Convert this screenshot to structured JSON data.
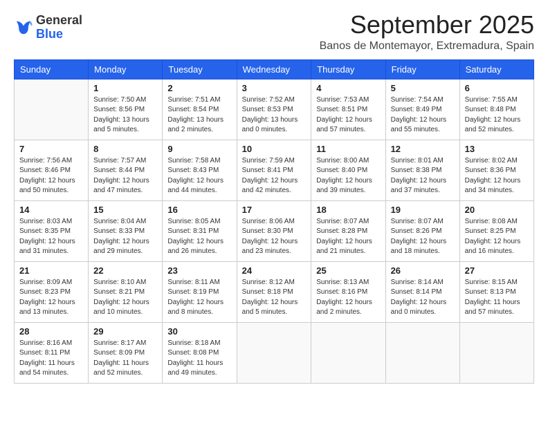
{
  "logo": {
    "general": "General",
    "blue": "Blue"
  },
  "title": "September 2025",
  "location": "Banos de Montemayor, Extremadura, Spain",
  "days_of_week": [
    "Sunday",
    "Monday",
    "Tuesday",
    "Wednesday",
    "Thursday",
    "Friday",
    "Saturday"
  ],
  "weeks": [
    [
      {
        "day": "",
        "info": ""
      },
      {
        "day": "1",
        "info": "Sunrise: 7:50 AM\nSunset: 8:56 PM\nDaylight: 13 hours\nand 5 minutes."
      },
      {
        "day": "2",
        "info": "Sunrise: 7:51 AM\nSunset: 8:54 PM\nDaylight: 13 hours\nand 2 minutes."
      },
      {
        "day": "3",
        "info": "Sunrise: 7:52 AM\nSunset: 8:53 PM\nDaylight: 13 hours\nand 0 minutes."
      },
      {
        "day": "4",
        "info": "Sunrise: 7:53 AM\nSunset: 8:51 PM\nDaylight: 12 hours\nand 57 minutes."
      },
      {
        "day": "5",
        "info": "Sunrise: 7:54 AM\nSunset: 8:49 PM\nDaylight: 12 hours\nand 55 minutes."
      },
      {
        "day": "6",
        "info": "Sunrise: 7:55 AM\nSunset: 8:48 PM\nDaylight: 12 hours\nand 52 minutes."
      }
    ],
    [
      {
        "day": "7",
        "info": "Sunrise: 7:56 AM\nSunset: 8:46 PM\nDaylight: 12 hours\nand 50 minutes."
      },
      {
        "day": "8",
        "info": "Sunrise: 7:57 AM\nSunset: 8:44 PM\nDaylight: 12 hours\nand 47 minutes."
      },
      {
        "day": "9",
        "info": "Sunrise: 7:58 AM\nSunset: 8:43 PM\nDaylight: 12 hours\nand 44 minutes."
      },
      {
        "day": "10",
        "info": "Sunrise: 7:59 AM\nSunset: 8:41 PM\nDaylight: 12 hours\nand 42 minutes."
      },
      {
        "day": "11",
        "info": "Sunrise: 8:00 AM\nSunset: 8:40 PM\nDaylight: 12 hours\nand 39 minutes."
      },
      {
        "day": "12",
        "info": "Sunrise: 8:01 AM\nSunset: 8:38 PM\nDaylight: 12 hours\nand 37 minutes."
      },
      {
        "day": "13",
        "info": "Sunrise: 8:02 AM\nSunset: 8:36 PM\nDaylight: 12 hours\nand 34 minutes."
      }
    ],
    [
      {
        "day": "14",
        "info": "Sunrise: 8:03 AM\nSunset: 8:35 PM\nDaylight: 12 hours\nand 31 minutes."
      },
      {
        "day": "15",
        "info": "Sunrise: 8:04 AM\nSunset: 8:33 PM\nDaylight: 12 hours\nand 29 minutes."
      },
      {
        "day": "16",
        "info": "Sunrise: 8:05 AM\nSunset: 8:31 PM\nDaylight: 12 hours\nand 26 minutes."
      },
      {
        "day": "17",
        "info": "Sunrise: 8:06 AM\nSunset: 8:30 PM\nDaylight: 12 hours\nand 23 minutes."
      },
      {
        "day": "18",
        "info": "Sunrise: 8:07 AM\nSunset: 8:28 PM\nDaylight: 12 hours\nand 21 minutes."
      },
      {
        "day": "19",
        "info": "Sunrise: 8:07 AM\nSunset: 8:26 PM\nDaylight: 12 hours\nand 18 minutes."
      },
      {
        "day": "20",
        "info": "Sunrise: 8:08 AM\nSunset: 8:25 PM\nDaylight: 12 hours\nand 16 minutes."
      }
    ],
    [
      {
        "day": "21",
        "info": "Sunrise: 8:09 AM\nSunset: 8:23 PM\nDaylight: 12 hours\nand 13 minutes."
      },
      {
        "day": "22",
        "info": "Sunrise: 8:10 AM\nSunset: 8:21 PM\nDaylight: 12 hours\nand 10 minutes."
      },
      {
        "day": "23",
        "info": "Sunrise: 8:11 AM\nSunset: 8:19 PM\nDaylight: 12 hours\nand 8 minutes."
      },
      {
        "day": "24",
        "info": "Sunrise: 8:12 AM\nSunset: 8:18 PM\nDaylight: 12 hours\nand 5 minutes."
      },
      {
        "day": "25",
        "info": "Sunrise: 8:13 AM\nSunset: 8:16 PM\nDaylight: 12 hours\nand 2 minutes."
      },
      {
        "day": "26",
        "info": "Sunrise: 8:14 AM\nSunset: 8:14 PM\nDaylight: 12 hours\nand 0 minutes."
      },
      {
        "day": "27",
        "info": "Sunrise: 8:15 AM\nSunset: 8:13 PM\nDaylight: 11 hours\nand 57 minutes."
      }
    ],
    [
      {
        "day": "28",
        "info": "Sunrise: 8:16 AM\nSunset: 8:11 PM\nDaylight: 11 hours\nand 54 minutes."
      },
      {
        "day": "29",
        "info": "Sunrise: 8:17 AM\nSunset: 8:09 PM\nDaylight: 11 hours\nand 52 minutes."
      },
      {
        "day": "30",
        "info": "Sunrise: 8:18 AM\nSunset: 8:08 PM\nDaylight: 11 hours\nand 49 minutes."
      },
      {
        "day": "",
        "info": ""
      },
      {
        "day": "",
        "info": ""
      },
      {
        "day": "",
        "info": ""
      },
      {
        "day": "",
        "info": ""
      }
    ]
  ]
}
